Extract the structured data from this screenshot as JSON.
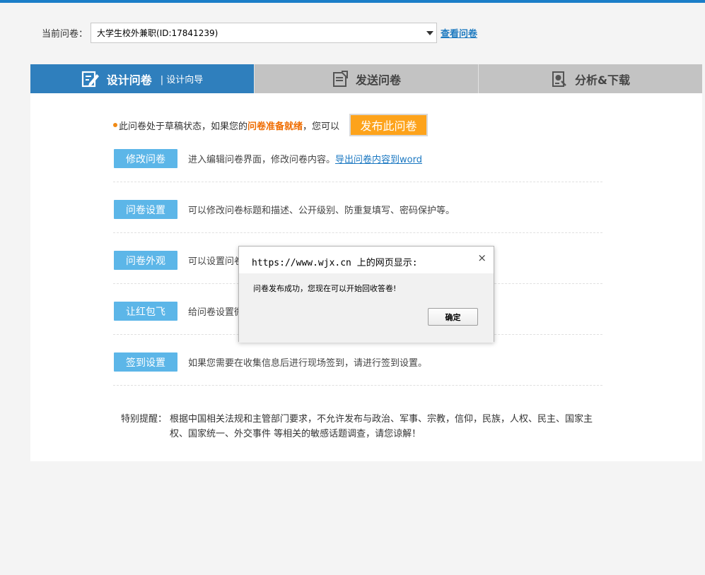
{
  "selector": {
    "label": "当前问卷：",
    "value": "大学生校外兼职(ID:17841239)",
    "view_link": "查看问卷"
  },
  "tabs": [
    {
      "label": "设计问卷",
      "sub": "| 设计向导",
      "icon": "edit-survey-icon",
      "active": true
    },
    {
      "label": "发送问卷",
      "icon": "send-survey-icon",
      "active": false
    },
    {
      "label": "分析&下载",
      "icon": "analysis-download-icon",
      "active": false
    }
  ],
  "status": {
    "prefix": "此问卷处于草稿状态，如果您的",
    "highlight": "问卷准备就绪",
    "suffix": "，您可以",
    "publish_button": "发布此问卷"
  },
  "actions": [
    {
      "button": "修改问卷",
      "desc": "进入编辑问卷界面，修改问卷内容。",
      "link": "导出问卷内容到word"
    },
    {
      "button": "问卷设置",
      "desc": "可以修改问卷标题和描述、公开级别、防重复填写、密码保护等。"
    },
    {
      "button": "问卷外观",
      "desc": "可以设置问卷"
    },
    {
      "button": "让红包飞",
      "desc": "给问卷设置微"
    },
    {
      "button": "签到设置",
      "desc": "如果您需要在收集信息后进行现场签到，请进行签到设置。"
    }
  ],
  "notice": {
    "label": "特别提醒：",
    "text": "根据中国相关法规和主管部门要求，不允许发布与政治、军事、宗教，信仰，民族，人权、民主、国家主权、国家统一、外交事件 等相关的敏感话题调查，请您谅解！"
  },
  "dialog": {
    "title": "https://www.wjx.cn 上的网页显示:",
    "close": "×",
    "message": "问卷发布成功，您现在可以开始回收答卷!",
    "ok_button": "确定"
  },
  "colors": {
    "accent": "#2f7fbd",
    "action_button": "#5cb6e8",
    "publish_button": "#fda31b",
    "tab_inactive": "#c3c3c3"
  }
}
